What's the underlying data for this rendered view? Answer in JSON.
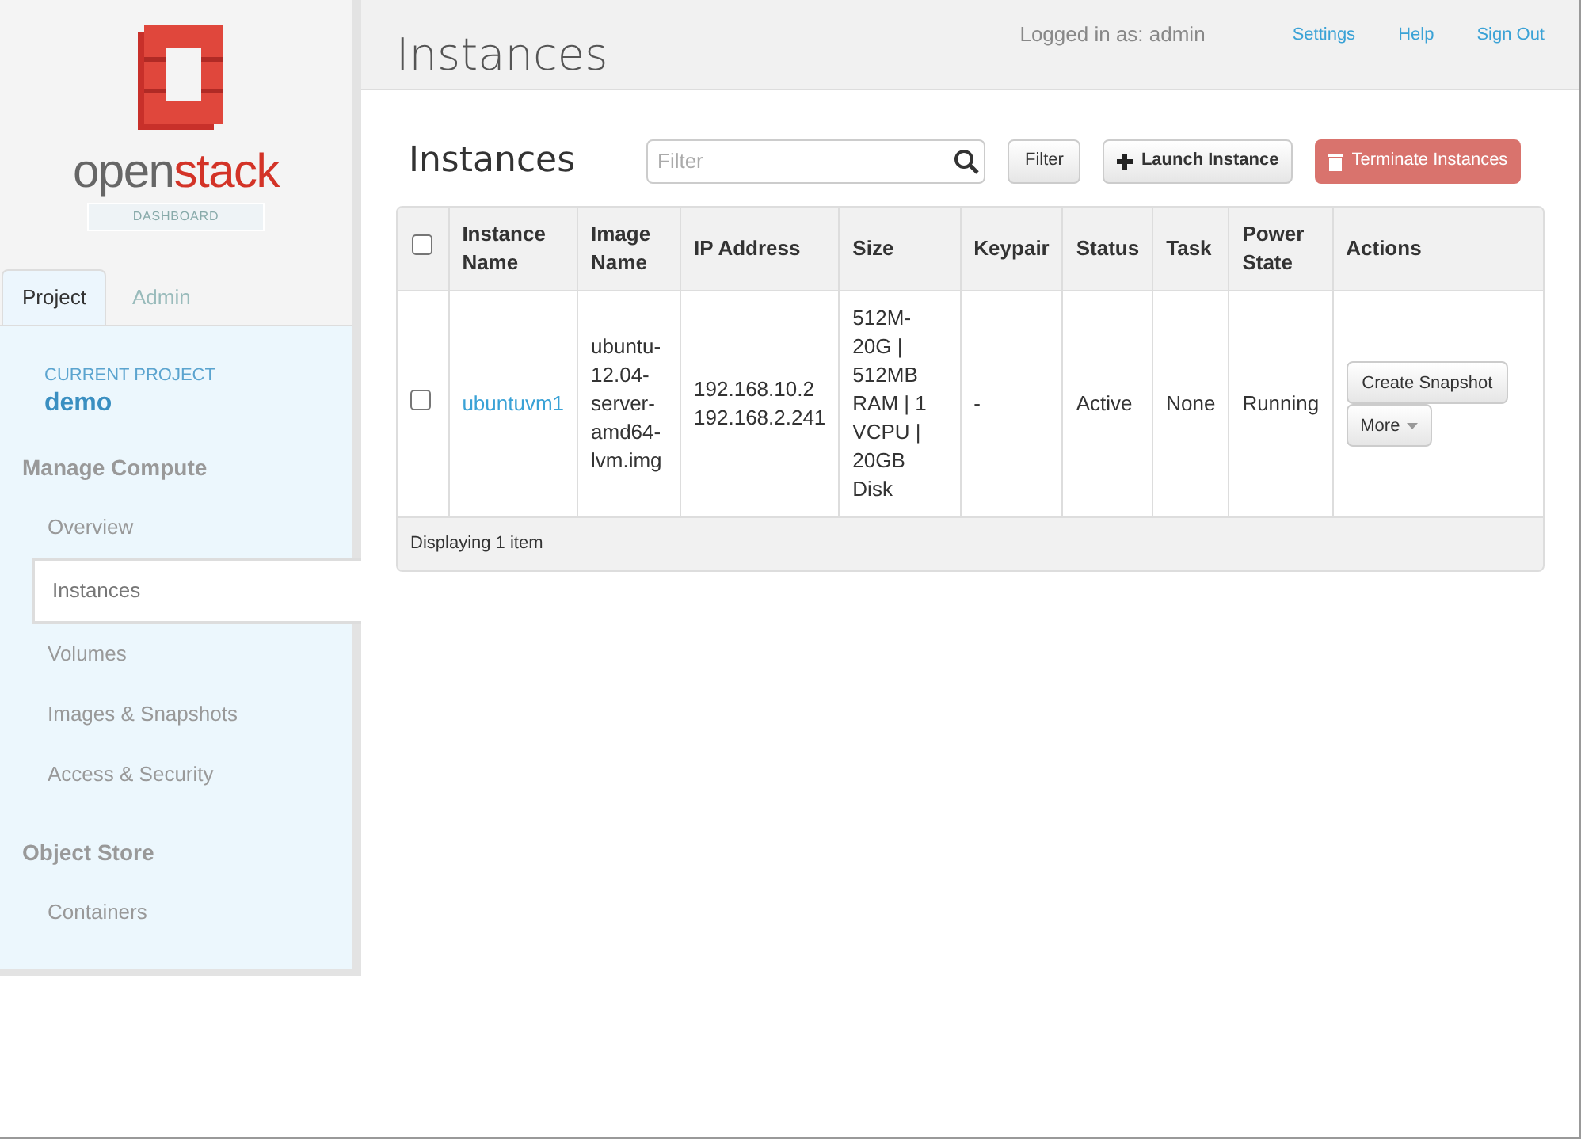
{
  "logo": {
    "word_1": "open",
    "word_2": "stack",
    "subtitle": "DASHBOARD"
  },
  "sidebar": {
    "tabs": [
      {
        "label": "Project",
        "selected": true
      },
      {
        "label": "Admin",
        "selected": false
      }
    ],
    "current_project": {
      "label": "CURRENT PROJECT",
      "name": "demo"
    },
    "groups": [
      {
        "heading": "Manage Compute",
        "items": [
          {
            "label": "Overview",
            "selected": false
          },
          {
            "label": "Instances",
            "selected": true
          },
          {
            "label": "Volumes",
            "selected": false
          },
          {
            "label": "Images & Snapshots",
            "selected": false
          },
          {
            "label": "Access & Security",
            "selected": false
          }
        ]
      },
      {
        "heading": "Object Store",
        "items": [
          {
            "label": "Containers",
            "selected": false
          }
        ]
      }
    ]
  },
  "header": {
    "title": "Instances",
    "user": "Logged in as: admin",
    "links": [
      "Settings",
      "Help",
      "Sign Out"
    ]
  },
  "toolbar": {
    "title": "Instances",
    "search": {
      "placeholder": "Filter"
    },
    "filter_button": "Filter",
    "launch_button": "Launch Instance",
    "terminate_button": "Terminate Instances"
  },
  "table": {
    "select_all": {
      "checked": false
    },
    "columns": [
      "Instance Name",
      "Image Name",
      "IP Address",
      "Size",
      "Keypair",
      "Status",
      "Task",
      "Power State",
      "Actions"
    ],
    "rows": [
      {
        "checked": false,
        "name": "ubuntuvm1",
        "image": "ubuntu-12.04-server-amd64-lvm.img",
        "ips": [
          "192.168.10.2",
          "192.168.2.241"
        ],
        "size": "512M-20G | 512MB RAM | 1 VCPU | 20GB Disk",
        "keypair": "-",
        "status": "Active",
        "task": "None",
        "power_state": "Running",
        "actions": {
          "primary": "Create Snapshot",
          "more": "More"
        }
      }
    ],
    "footer": "Displaying 1 item"
  }
}
